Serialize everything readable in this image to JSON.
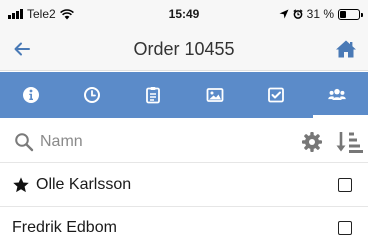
{
  "status_bar": {
    "carrier": "Tele2",
    "time": "15:49",
    "battery": "31 %"
  },
  "header": {
    "title": "Order 10455",
    "back_icon": "arrow-left-icon",
    "home_icon": "home-icon"
  },
  "tabs": [
    {
      "icon": "info-icon",
      "active": false
    },
    {
      "icon": "clock-icon",
      "active": false
    },
    {
      "icon": "clipboard-icon",
      "active": false
    },
    {
      "icon": "image-icon",
      "active": false
    },
    {
      "icon": "check-square-icon",
      "active": false
    },
    {
      "icon": "users-icon",
      "active": true
    }
  ],
  "search": {
    "placeholder": "Namn",
    "value": ""
  },
  "people": [
    {
      "name": "Olle Karlsson",
      "starred": true,
      "checked": false
    },
    {
      "name": "Fredrik Edbom",
      "starred": false,
      "checked": false
    }
  ],
  "colors": {
    "accent": "#5b8bc9",
    "back_arrow": "#4a7ab6"
  }
}
